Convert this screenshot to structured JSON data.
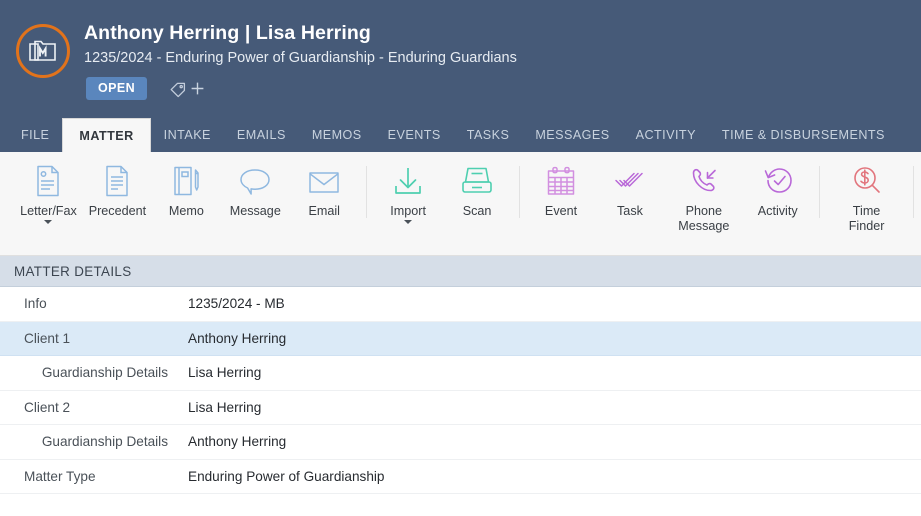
{
  "header": {
    "avatar_icon": "matter-folder-m-icon",
    "avatar_ring_color": "#e2731b",
    "title": "Anthony Herring | Lisa Herring",
    "subtitle": "1235/2024 - Enduring Power of Guardianship - Enduring Guardians",
    "status_badge": "OPEN",
    "status_badge_color": "#5a86bd",
    "tag_icon": "tag-icon",
    "add_tag_icon": "plus-icon",
    "background_color": "#465a78"
  },
  "tabs": [
    {
      "label": "FILE",
      "active": false
    },
    {
      "label": "MATTER",
      "active": true
    },
    {
      "label": "INTAKE",
      "active": false
    },
    {
      "label": "EMAILS",
      "active": false
    },
    {
      "label": "MEMOS",
      "active": false
    },
    {
      "label": "EVENTS",
      "active": false
    },
    {
      "label": "TASKS",
      "active": false
    },
    {
      "label": "MESSAGES",
      "active": false
    },
    {
      "label": "ACTIVITY",
      "active": false
    },
    {
      "label": "TIME & DISBURSEMENTS",
      "active": false
    }
  ],
  "toolbar": {
    "items": [
      {
        "label": "Letter/Fax",
        "icon": "letter-fax-icon",
        "color": "#8fb8e0",
        "dropdown": true
      },
      {
        "label": "Precedent",
        "icon": "precedent-document-icon",
        "color": "#8fb8e0",
        "dropdown": false
      },
      {
        "label": "Memo",
        "icon": "memo-notebook-pencil-icon",
        "color": "#8fb8e0",
        "dropdown": false
      },
      {
        "label": "Message",
        "icon": "message-speech-bubble-icon",
        "color": "#8fb8e0",
        "dropdown": false
      },
      {
        "label": "Email",
        "icon": "email-envelope-icon",
        "color": "#8fb8e0",
        "dropdown": false
      },
      {
        "label": "Import",
        "icon": "import-download-arrow-icon",
        "color": "#4ecfb0",
        "dropdown": true
      },
      {
        "label": "Scan",
        "icon": "scanner-icon",
        "color": "#4ecfb0",
        "dropdown": false
      },
      {
        "label": "Event",
        "icon": "calendar-event-icon",
        "color": "#d28fe0",
        "dropdown": false
      },
      {
        "label": "Task",
        "icon": "task-checkmarks-icon",
        "color": "#b968d8",
        "dropdown": false
      },
      {
        "label": "Phone\nMessage",
        "icon": "phone-incoming-call-icon",
        "color": "#b968d8",
        "dropdown": false
      },
      {
        "label": "Activity",
        "icon": "activity-clock-check-icon",
        "color": "#b968d8",
        "dropdown": false
      },
      {
        "label": "Time\nFinder",
        "icon": "time-finder-dollar-magnifier-icon",
        "color": "#e2757d",
        "dropdown": false
      }
    ],
    "separator_after": [
      "Email",
      "Scan",
      "Activity",
      "Time\nFinder"
    ]
  },
  "section": {
    "title": "MATTER DETAILS"
  },
  "details": {
    "rows": [
      {
        "label": "Info",
        "value": "1235/2024 - MB",
        "sub": false,
        "highlighted": false
      },
      {
        "label": "Client 1",
        "value": "Anthony Herring",
        "sub": false,
        "highlighted": true
      },
      {
        "label": "Guardianship Details",
        "value": "Lisa Herring",
        "sub": true,
        "highlighted": false
      },
      {
        "label": "Client 2",
        "value": "Lisa Herring",
        "sub": false,
        "highlighted": false
      },
      {
        "label": "Guardianship Details",
        "value": "Anthony Herring",
        "sub": true,
        "highlighted": false
      },
      {
        "label": "Matter Type",
        "value": "Enduring Power of Guardianship",
        "sub": false,
        "highlighted": false
      }
    ]
  }
}
